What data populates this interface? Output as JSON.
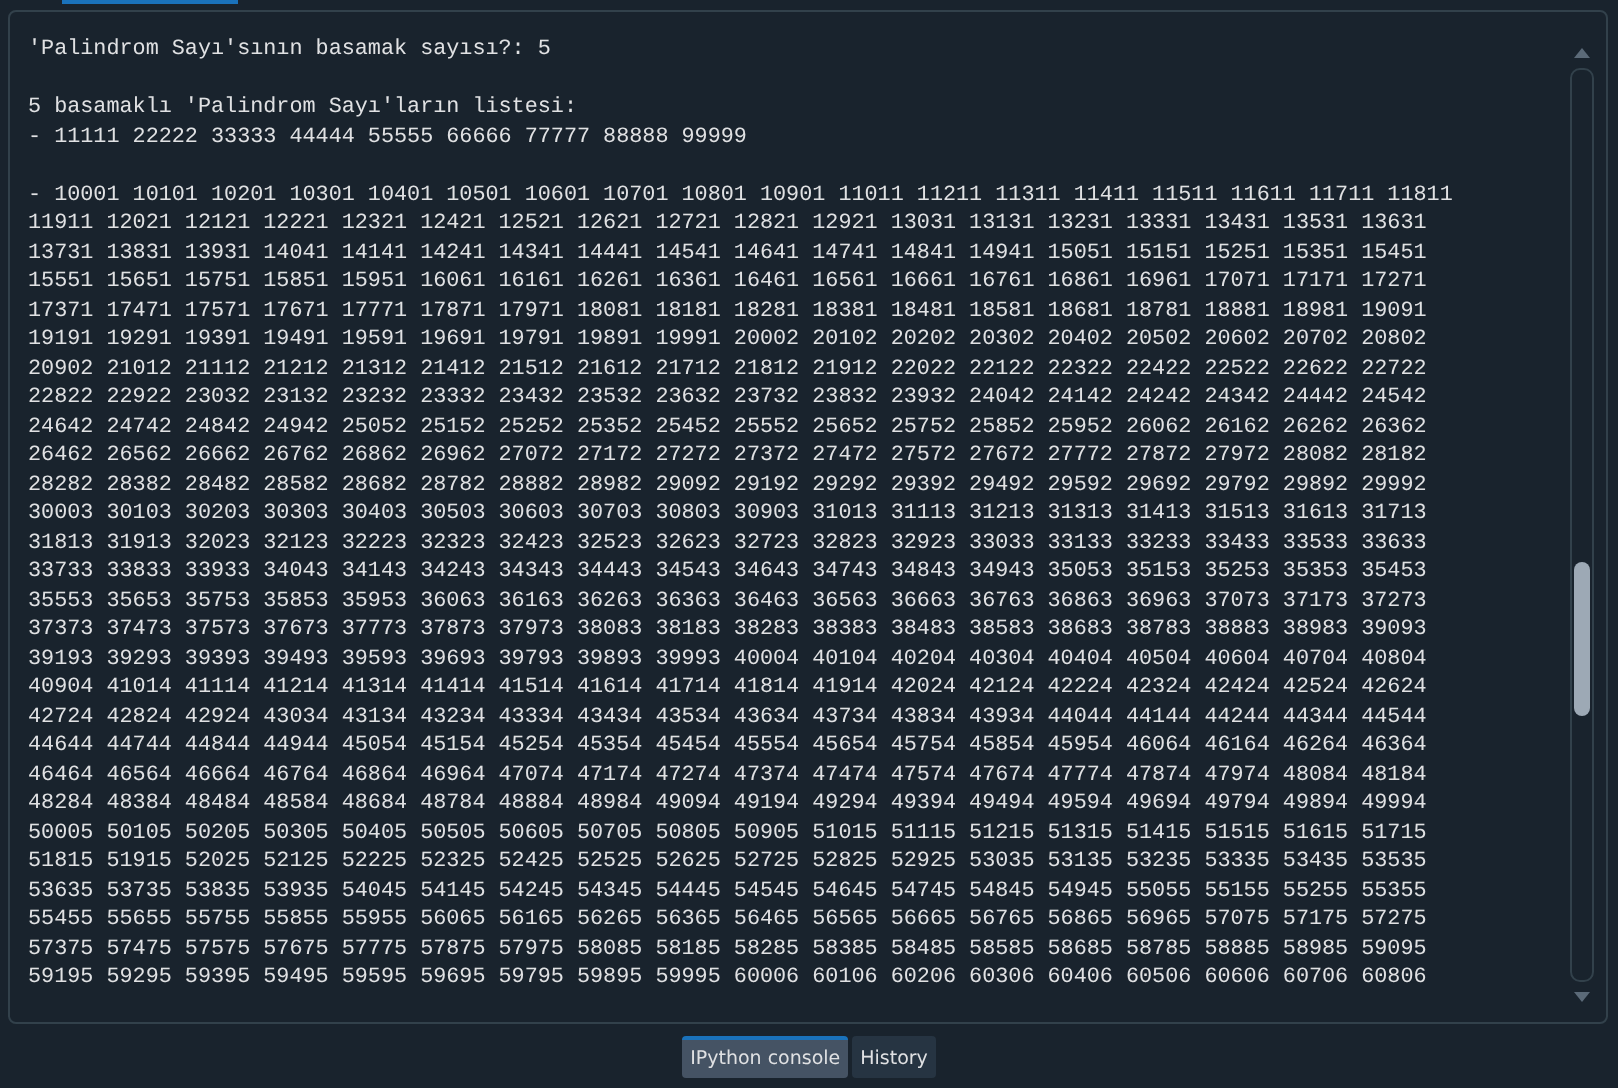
{
  "console": {
    "paragraphs": [
      [
        "'Palindrom Sayı'sının basamak sayısı?: 5"
      ],
      [
        "5 basamaklı 'Palindrom Sayı'ların listesi:",
        "- 11111 22222 33333 44444 55555 66666 77777 88888 99999"
      ],
      [
        "- 10001 10101 10201 10301 10401 10501 10601 10701 10801 10901 11011 11211 11311 11411 11511 11611 11711 11811",
        "11911 12021 12121 12221 12321 12421 12521 12621 12721 12821 12921 13031 13131 13231 13331 13431 13531 13631",
        "13731 13831 13931 14041 14141 14241 14341 14441 14541 14641 14741 14841 14941 15051 15151 15251 15351 15451",
        "15551 15651 15751 15851 15951 16061 16161 16261 16361 16461 16561 16661 16761 16861 16961 17071 17171 17271",
        "17371 17471 17571 17671 17771 17871 17971 18081 18181 18281 18381 18481 18581 18681 18781 18881 18981 19091",
        "19191 19291 19391 19491 19591 19691 19791 19891 19991 20002 20102 20202 20302 20402 20502 20602 20702 20802",
        "20902 21012 21112 21212 21312 21412 21512 21612 21712 21812 21912 22022 22122 22322 22422 22522 22622 22722",
        "22822 22922 23032 23132 23232 23332 23432 23532 23632 23732 23832 23932 24042 24142 24242 24342 24442 24542",
        "24642 24742 24842 24942 25052 25152 25252 25352 25452 25552 25652 25752 25852 25952 26062 26162 26262 26362",
        "26462 26562 26662 26762 26862 26962 27072 27172 27272 27372 27472 27572 27672 27772 27872 27972 28082 28182",
        "28282 28382 28482 28582 28682 28782 28882 28982 29092 29192 29292 29392 29492 29592 29692 29792 29892 29992",
        "30003 30103 30203 30303 30403 30503 30603 30703 30803 30903 31013 31113 31213 31313 31413 31513 31613 31713",
        "31813 31913 32023 32123 32223 32323 32423 32523 32623 32723 32823 32923 33033 33133 33233 33433 33533 33633",
        "33733 33833 33933 34043 34143 34243 34343 34443 34543 34643 34743 34843 34943 35053 35153 35253 35353 35453",
        "35553 35653 35753 35853 35953 36063 36163 36263 36363 36463 36563 36663 36763 36863 36963 37073 37173 37273",
        "37373 37473 37573 37673 37773 37873 37973 38083 38183 38283 38383 38483 38583 38683 38783 38883 38983 39093",
        "39193 39293 39393 39493 39593 39693 39793 39893 39993 40004 40104 40204 40304 40404 40504 40604 40704 40804",
        "40904 41014 41114 41214 41314 41414 41514 41614 41714 41814 41914 42024 42124 42224 42324 42424 42524 42624",
        "42724 42824 42924 43034 43134 43234 43334 43434 43534 43634 43734 43834 43934 44044 44144 44244 44344 44544",
        "44644 44744 44844 44944 45054 45154 45254 45354 45454 45554 45654 45754 45854 45954 46064 46164 46264 46364",
        "46464 46564 46664 46764 46864 46964 47074 47174 47274 47374 47474 47574 47674 47774 47874 47974 48084 48184",
        "48284 48384 48484 48584 48684 48784 48884 48984 49094 49194 49294 49394 49494 49594 49694 49794 49894 49994",
        "50005 50105 50205 50305 50405 50505 50605 50705 50805 50905 51015 51115 51215 51315 51415 51515 51615 51715",
        "51815 51915 52025 52125 52225 52325 52425 52525 52625 52725 52825 52925 53035 53135 53235 53335 53435 53535",
        "53635 53735 53835 53935 54045 54145 54245 54345 54445 54545 54645 54745 54845 54945 55055 55155 55255 55355",
        "55455 55655 55755 55855 55955 56065 56165 56265 56365 56465 56565 56665 56765 56865 56965 57075 57175 57275",
        "57375 57475 57575 57675 57775 57875 57975 58085 58185 58285 58385 58485 58585 58685 58785 58885 58985 59095",
        "59195 59295 59395 59495 59595 59695 59795 59895 59995 60006 60106 60206 60306 60406 60506 60606 60706 60806"
      ]
    ]
  },
  "tabs": [
    {
      "label": "IPython console",
      "selected": true
    },
    {
      "label": "History",
      "selected": false
    }
  ]
}
